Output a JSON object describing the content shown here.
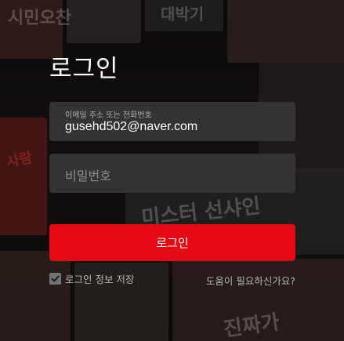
{
  "backdrop": {
    "poster_texts": [
      "시민오찬",
      "대박기",
      "미스터 선샤인",
      "진짜가",
      "사람"
    ]
  },
  "login": {
    "title": "로그인",
    "email": {
      "label": "이메일 주소 또는 전화번호",
      "value": "gusehd502@naver.com"
    },
    "password": {
      "placeholder": "비밀번호"
    },
    "submit_label": "로그인",
    "remember": {
      "label": "로그인 정보 저장",
      "checked": true
    },
    "help_label": "도움이 필요하신가요?"
  },
  "colors": {
    "accent": "#e50914",
    "field_bg": "#333333",
    "muted_text": "#b3b3b3"
  }
}
